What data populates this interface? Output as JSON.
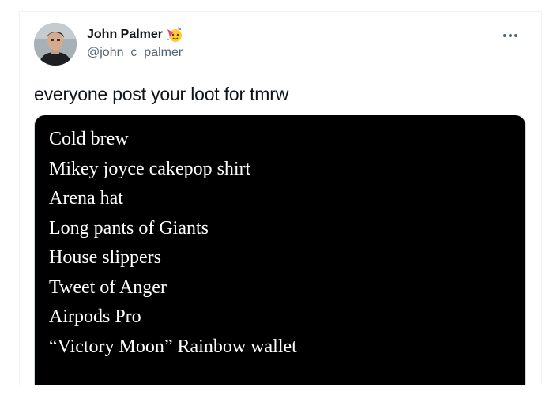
{
  "tweet": {
    "author": {
      "display_name": "John Palmer",
      "handle": "@john_c_palmer",
      "badge_icon": "party-face-icon"
    },
    "text": "everyone post your loot for tmrw",
    "more_icon": "more-options-icon",
    "media": {
      "background": "#000000",
      "items": [
        "Cold brew",
        "Mikey joyce cakepop shirt",
        "Arena hat",
        "Long pants of Giants",
        "House slippers",
        "Tweet of Anger",
        "Airpods Pro",
        "“Victory Moon” Rainbow wallet"
      ]
    }
  },
  "colors": {
    "text_primary": "#0f1419",
    "text_secondary": "#536471",
    "border": "#eff3f4"
  }
}
